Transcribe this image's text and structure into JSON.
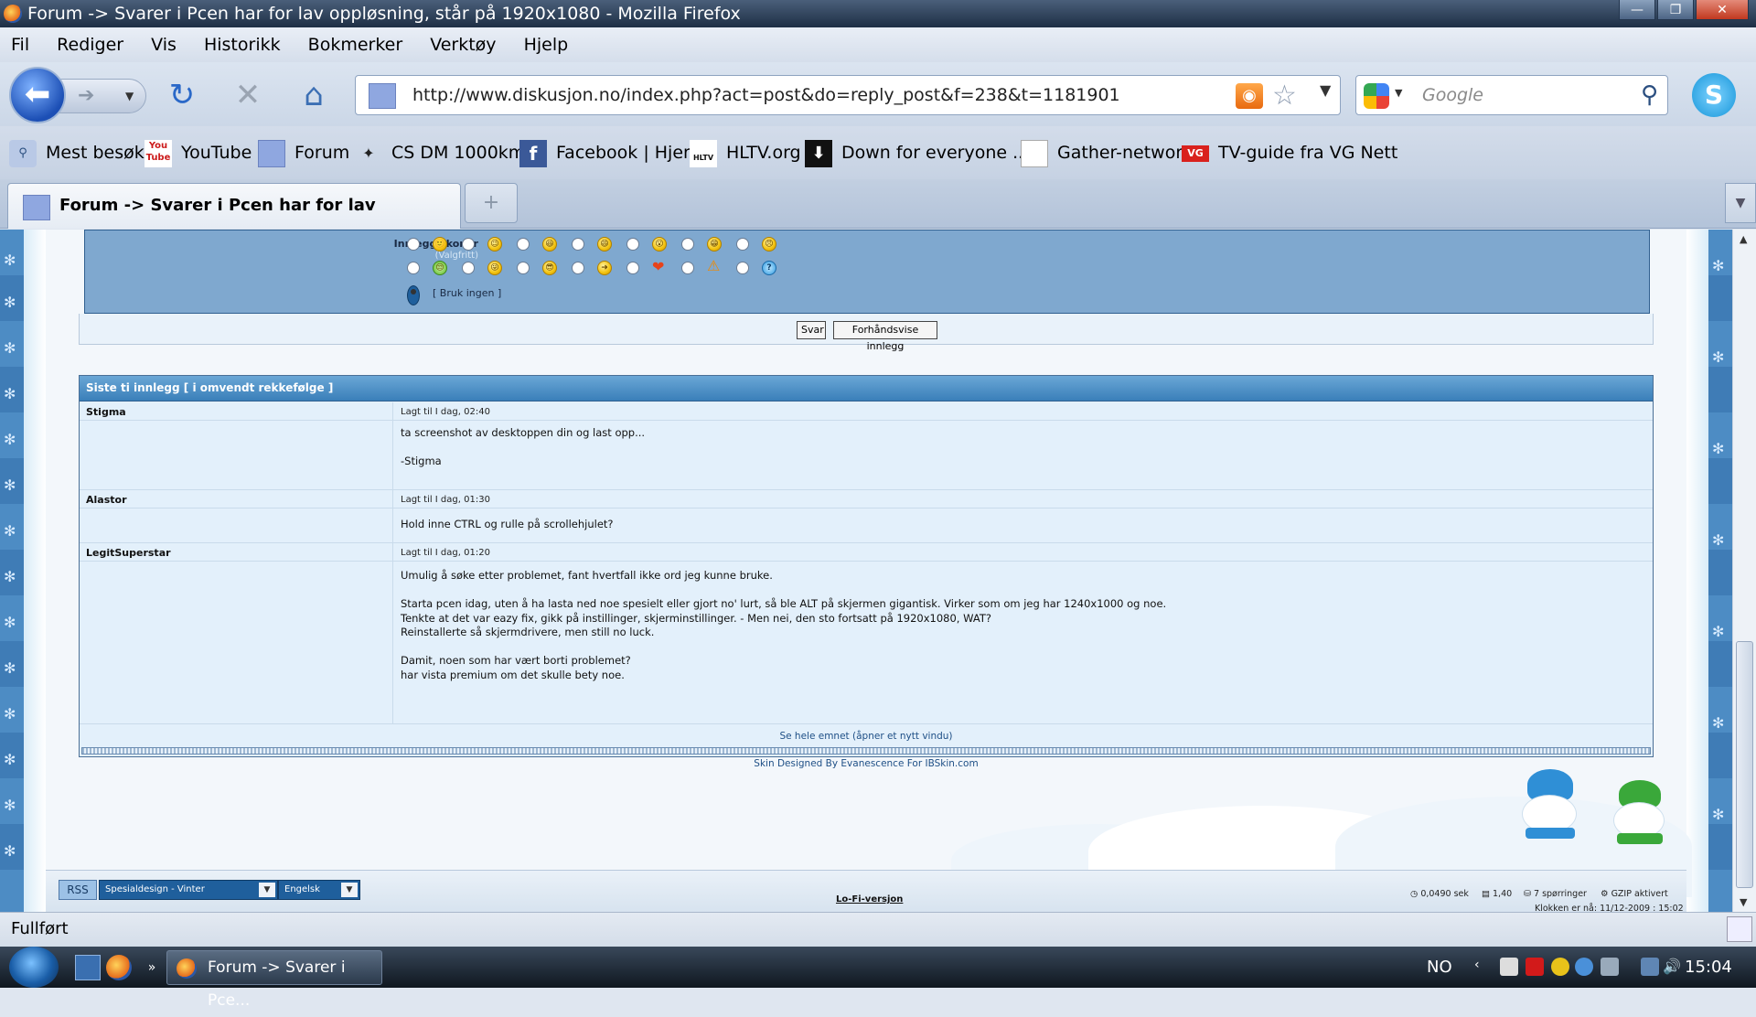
{
  "window": {
    "title": "Forum -> Svarer i Pcen har for lav oppløsning, står på 1920x1080 - Mozilla Firefox",
    "min_label": "—",
    "max_label": "❐",
    "close_label": "✕"
  },
  "menu": [
    "Fil",
    "Rediger",
    "Vis",
    "Historikk",
    "Bokmerker",
    "Verktøy",
    "Hjelp"
  ],
  "nav": {
    "url": "http://www.diskusjon.no/index.php?act=post&do=reply_post&f=238&t=1181901",
    "search_placeholder": "Google"
  },
  "bookmarks": [
    {
      "label": "Mest besøkt",
      "icon": "magnifier-icon"
    },
    {
      "label": "YouTube",
      "icon": "youtube-icon",
      "badge": "You\nTube"
    },
    {
      "label": "Forum",
      "icon": "forum-icon"
    },
    {
      "label": "CS DM 1000km",
      "icon": "cs-icon"
    },
    {
      "label": "Facebook | Hjem",
      "icon": "facebook-icon",
      "badge": "f"
    },
    {
      "label": "HLTV.org",
      "icon": "hltv-icon",
      "badge": "HLTV"
    },
    {
      "label": "Down for everyone ...",
      "icon": "down-icon"
    },
    {
      "label": "Gather-network",
      "icon": "page-icon"
    },
    {
      "label": "TV-guide fra VG Nett",
      "icon": "vg-icon",
      "badge": "VG"
    }
  ],
  "tab": {
    "title": "Forum -> Svarer i Pcen har for lav oppløsning, st...",
    "new_tab_label": "+"
  },
  "post_icons": {
    "label": "Innleggsikoner",
    "sub": "(Valgfritt)",
    "none_label": "[ Bruk ingen ]",
    "row1": [
      "🙂",
      "😉",
      "😆",
      "😄",
      "😮",
      "😁",
      "😠"
    ],
    "row2": [
      "😒",
      "😜",
      "😎",
      "➜",
      "❤",
      "⚠",
      "?"
    ]
  },
  "buttons": {
    "reply": "Svar",
    "preview": "Forhåndsvise innlegg"
  },
  "recent": {
    "title": "Siste ti innlegg [ i omvendt rekkefølge ]",
    "posts": [
      {
        "author": "Stigma",
        "date": "Lagt til I dag, 02:40",
        "body": "ta screenshot av desktoppen din og last opp...\n\n-Stigma"
      },
      {
        "author": "Alastor",
        "date": "Lagt til I dag, 01:30",
        "body": "Hold inne CTRL og rulle på scrollehjulet?"
      },
      {
        "author": "LegitSuperstar",
        "date": "Lagt til I dag, 01:20",
        "body": "Umulig å søke etter problemet, fant hvertfall ikke ord jeg kunne bruke.\n\nStarta pcen idag, uten å ha lasta ned noe spesielt eller gjort no' lurt, så ble ALT på skjermen gigantisk. Virker som om jeg har 1240x1000 og noe.\nTenkte at det var eazy fix, gikk på instillinger, skjerminstillinger. - Men nei, den sto fortsatt på 1920x1080, WAT?\nReinstallerte så skjermdrivere, men still no luck.\n\nDamit, noen som har vært borti problemet?\nhar vista premium om det skulle bety noe."
      }
    ],
    "see_all": "Se hele emnet (åpner et nytt vindu)"
  },
  "skin_credit": "Skin Designed By Evanescence For IBSkin.com",
  "footer": {
    "rss": "RSS",
    "skin_select": "Spesialdesign - Vinter",
    "lang_select": "Engelsk",
    "lofi": "Lo-Fi-versjon",
    "time_stat": "0,0490 sek",
    "load_stat": "1,40",
    "queries_stat": "7 spørringer",
    "gzip_stat": "GZIP aktivert",
    "clock": "Klokken er nå: 11/12-2009 : 15:02"
  },
  "status": "Fullført",
  "taskbar": {
    "task_title": "Forum -> Svarer i Pce...",
    "lang": "NO",
    "time": "15:04"
  }
}
